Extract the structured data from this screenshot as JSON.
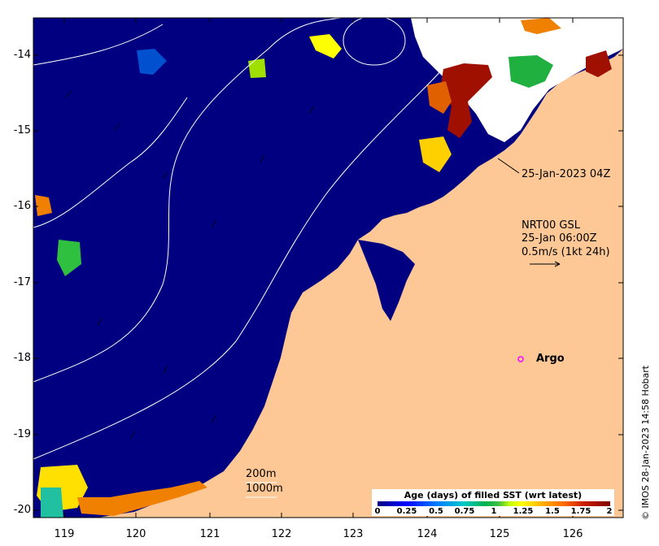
{
  "axes": {
    "x_ticks": [
      "119",
      "120",
      "121",
      "122",
      "123",
      "124",
      "125",
      "126"
    ],
    "y_ticks": [
      "-14",
      "-15",
      "-16",
      "-17",
      "-18",
      "-19",
      "-20"
    ]
  },
  "annotations": {
    "drifter_label": "25-Jan-2023 04Z",
    "current_product_line1": "NRT00 GSL",
    "current_product_line2": "25-Jan 06:00Z",
    "current_scale_label": "0.5m/s (1kt 24h)",
    "argo_label": "Argo",
    "contour_200": "200m",
    "contour_1000": "1000m"
  },
  "legend": {
    "title": "Age (days) of filled SST (wrt latest)",
    "ticks": [
      "0",
      "0.25",
      "0.5",
      "0.75",
      "1",
      "1.25",
      "1.5",
      "1.75",
      "2"
    ]
  },
  "credit": "© IMOS 28-Jan-2023 14:58 Hobart",
  "colors": {
    "ocean": "#000080",
    "land": "#fdc896",
    "argo_marker": "#ff00ff",
    "contour": "#ffffff"
  }
}
